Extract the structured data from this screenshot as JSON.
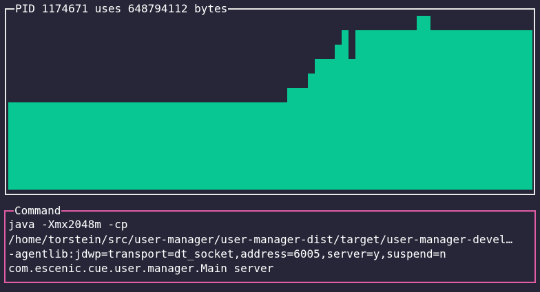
{
  "memory_panel": {
    "title": "PID 1174671 uses 648794112 bytes",
    "bar_color": "#08c793",
    "border_color": "#e8e8e8",
    "history_levels": [
      6,
      6,
      6,
      6,
      6,
      6,
      6,
      6,
      6,
      6,
      6,
      6,
      6,
      6,
      6,
      6,
      6,
      6,
      6,
      6,
      6,
      6,
      6,
      6,
      6,
      6,
      6,
      6,
      6,
      6,
      6,
      6,
      6,
      6,
      6,
      6,
      6,
      6,
      6,
      6,
      6,
      7,
      7,
      7,
      8,
      9,
      9,
      9,
      10,
      11,
      9,
      11,
      11,
      11,
      11,
      11,
      11,
      11,
      11,
      11,
      12,
      12,
      11,
      11,
      11,
      11,
      11,
      11,
      11,
      11,
      11,
      11,
      11,
      11,
      11,
      11,
      11
    ],
    "max_level": 12
  },
  "command_panel": {
    "title": "Command",
    "border_color": "#e25ca6",
    "lines": [
      "java -Xmx2048m -cp",
      "/home/torstein/src/user-manager/user-manager-dist/target/user-manager-devel…",
      "-agentlib:jdwp=transport=dt_socket,address=6005,server=y,suspend=n",
      "com.escenic.cue.user.manager.Main server"
    ]
  }
}
